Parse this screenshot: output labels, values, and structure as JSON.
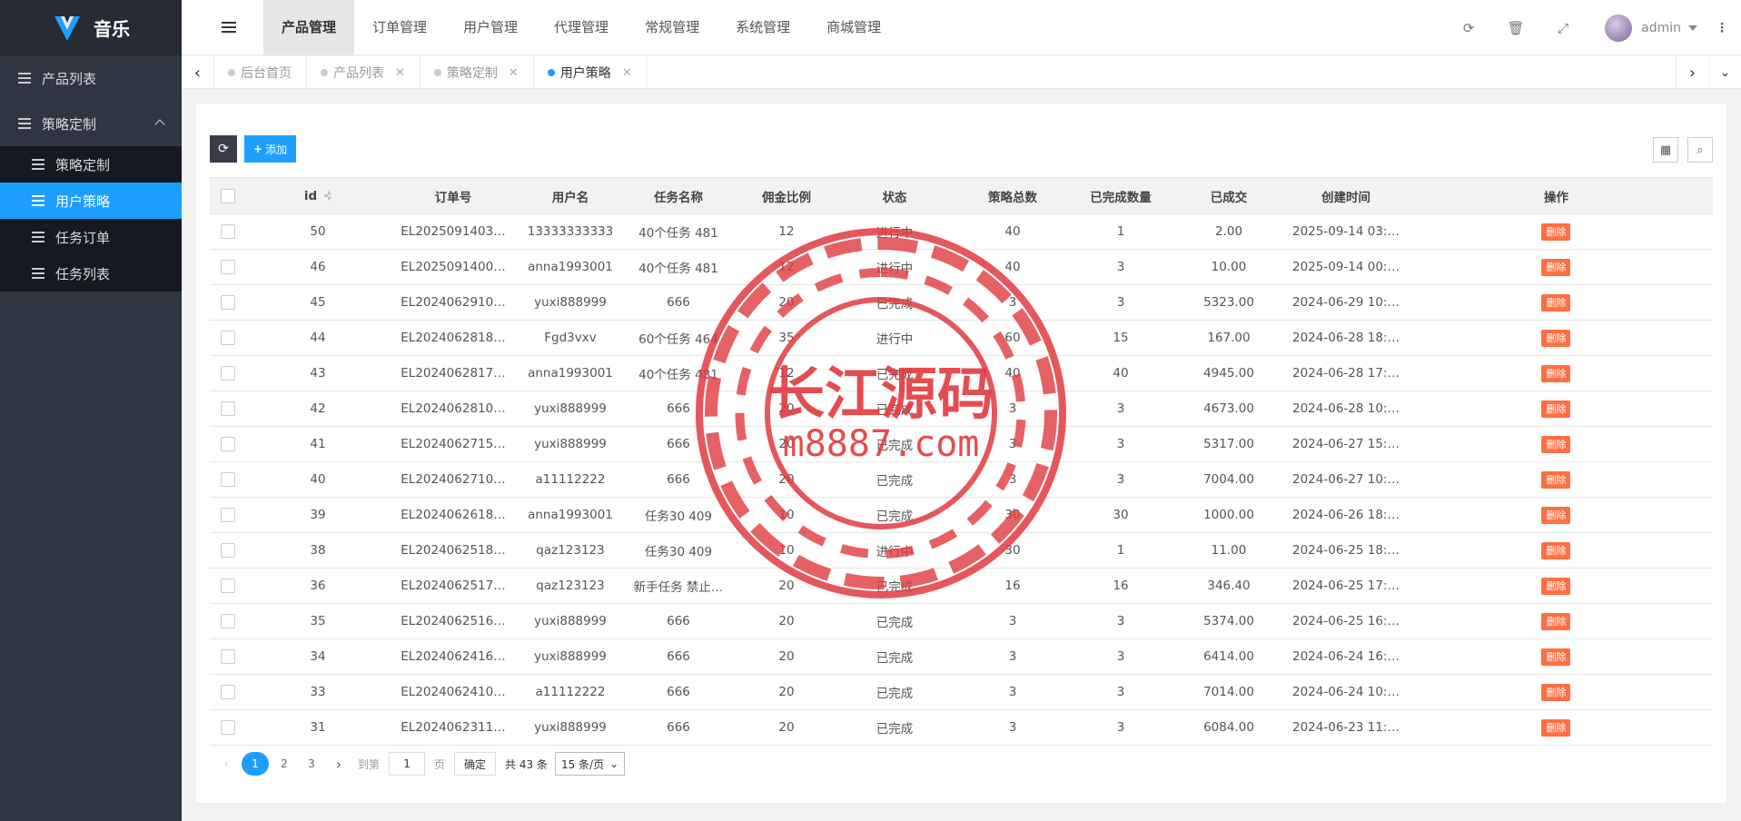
{
  "app": {
    "title": "音乐"
  },
  "sidebar": {
    "items": [
      {
        "label": "产品列表"
      },
      {
        "label": "策略定制"
      }
    ],
    "sub_items": [
      {
        "label": "策略定制"
      },
      {
        "label": "用户策略"
      },
      {
        "label": "任务订单"
      },
      {
        "label": "任务列表"
      }
    ]
  },
  "topnav": [
    "产品管理",
    "订单管理",
    "用户管理",
    "代理管理",
    "常规管理",
    "系统管理",
    "商城管理"
  ],
  "user": {
    "name": "admin"
  },
  "tabs": [
    "后台首页",
    "产品列表",
    "策略定制",
    "用户策略"
  ],
  "toolbar": {
    "add_label": "添加"
  },
  "table": {
    "headers": [
      "id",
      "订单号",
      "用户名",
      "任务名称",
      "佣金比例",
      "状态",
      "策略总数",
      "已完成数量",
      "已成交",
      "创建时间",
      "操作"
    ],
    "rows": [
      [
        "50",
        "EL2025091403…",
        "13333333333",
        "40个任务 481",
        "12",
        "进行中",
        "40",
        "1",
        "2.00",
        "2025-09-14 03:…"
      ],
      [
        "46",
        "EL2025091400…",
        "anna1993001",
        "40个任务 481",
        "12",
        "进行中",
        "40",
        "3",
        "10.00",
        "2025-09-14 00:…"
      ],
      [
        "45",
        "EL2024062910…",
        "yuxi888999",
        "666",
        "20",
        "已完成",
        "3",
        "3",
        "5323.00",
        "2024-06-29 10:…"
      ],
      [
        "44",
        "EL2024062818…",
        "Fgd3vxv",
        "60个任务 464",
        "35",
        "进行中",
        "60",
        "15",
        "167.00",
        "2024-06-28 18:…"
      ],
      [
        "43",
        "EL2024062817…",
        "anna1993001",
        "40个任务 481",
        "12",
        "已完成",
        "40",
        "40",
        "4945.00",
        "2024-06-28 17:…"
      ],
      [
        "42",
        "EL2024062810…",
        "yuxi888999",
        "666",
        "20",
        "已完成",
        "3",
        "3",
        "4673.00",
        "2024-06-28 10:…"
      ],
      [
        "41",
        "EL2024062715…",
        "yuxi888999",
        "666",
        "20",
        "已完成",
        "3",
        "3",
        "5317.00",
        "2024-06-27 15:…"
      ],
      [
        "40",
        "EL2024062710…",
        "a11112222",
        "666",
        "20",
        "已完成",
        "3",
        "3",
        "7004.00",
        "2024-06-27 10:…"
      ],
      [
        "39",
        "EL2024062618…",
        "anna1993001",
        "任务30 409",
        "10",
        "已完成",
        "30",
        "30",
        "1000.00",
        "2024-06-26 18:…"
      ],
      [
        "38",
        "EL2024062518…",
        "qaz123123",
        "任务30 409",
        "10",
        "进行中",
        "30",
        "1",
        "11.00",
        "2024-06-25 18:…"
      ],
      [
        "36",
        "EL2024062517…",
        "qaz123123",
        "新手任务 禁止…",
        "20",
        "已完成",
        "16",
        "16",
        "346.40",
        "2024-06-25 17:…"
      ],
      [
        "35",
        "EL2024062516…",
        "yuxi888999",
        "666",
        "20",
        "已完成",
        "3",
        "3",
        "5374.00",
        "2024-06-25 16:…"
      ],
      [
        "34",
        "EL2024062416…",
        "yuxi888999",
        "666",
        "20",
        "已完成",
        "3",
        "3",
        "6414.00",
        "2024-06-24 16:…"
      ],
      [
        "33",
        "EL2024062410…",
        "a11112222",
        "666",
        "20",
        "已完成",
        "3",
        "3",
        "7014.00",
        "2024-06-24 10:…"
      ],
      [
        "31",
        "EL2024062311…",
        "yuxi888999",
        "666",
        "20",
        "已完成",
        "3",
        "3",
        "6084.00",
        "2024-06-23 11:…"
      ]
    ],
    "delete_label": "删除"
  },
  "pager": {
    "pages": [
      "1",
      "2",
      "3"
    ],
    "goto_label": "到第",
    "page_value": "1",
    "page_unit": "页",
    "confirm": "确定",
    "total": "共 43 条",
    "per_page": "15 条/页"
  },
  "watermark": {
    "text1": "长江源码",
    "text2": "m8887.com"
  }
}
